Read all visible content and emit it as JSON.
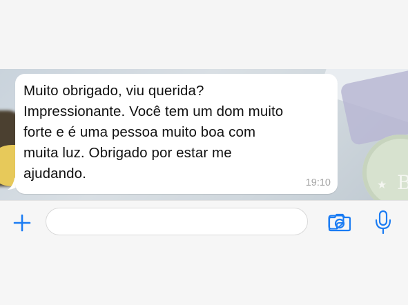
{
  "chat": {
    "message": {
      "text": "Muito obrigado, viu querida?\nImpressionante. Você tem um dom muito\nforte e é uma pessoa muito boa com\nmuita luz. Obrigado por estar me\najudando.",
      "time": "19:10"
    }
  },
  "input_bar": {
    "placeholder": "",
    "icons": {
      "add": "plus-icon",
      "sticker": "sticker-icon",
      "camera": "camera-icon",
      "mic": "microphone-icon"
    }
  },
  "colors": {
    "accent": "#1b7cf3",
    "bubble": "#ffffff",
    "timestamp": "#a5a5a5"
  }
}
